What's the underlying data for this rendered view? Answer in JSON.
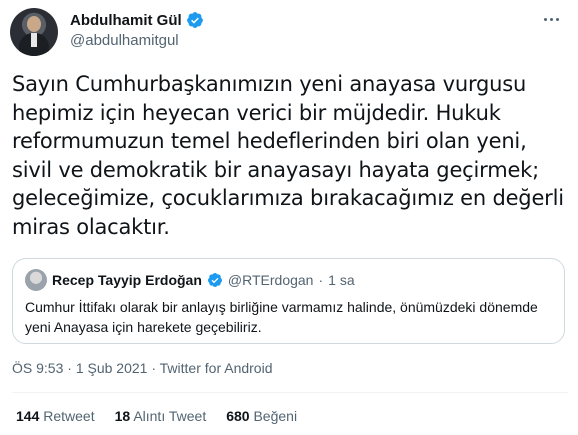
{
  "author": {
    "name": "Abdulhamit Gül",
    "handle": "@abdulhamitgul"
  },
  "tweet": {
    "text": "Sayın Cumhurbaşkanımızın yeni anayasa vurgusu hepimiz için heyecan verici bir müjdedir. Hukuk reformumuzun temel hedeflerinden biri olan yeni, sivil ve demokratik bir anayasayı hayata geçirmek; geleceğimize, çocuklarımıza bırakacağımız en değerli miras olacaktır."
  },
  "quote": {
    "name": "Recep Tayyip Erdoğan",
    "handle": "@RTErdogan",
    "separator": "·",
    "time": "1 sa",
    "text": "Cumhur İttifakı olarak bir anlayış birliğine varmamız halinde, önümüzdeki dönemde yeni Anayasa için harekete geçebiliriz."
  },
  "meta": {
    "time": "ÖS 9:53",
    "date": "1 Şub 2021",
    "separator": "·",
    "source": "Twitter for Android"
  },
  "stats": {
    "retweets_count": "144",
    "retweets_label": "Retweet",
    "quotes_count": "18",
    "quotes_label": "Alıntı Tweet",
    "likes_count": "680",
    "likes_label": "Beğeni"
  },
  "colors": {
    "verified": "#1d9bf0",
    "text": "#0f1419",
    "secondary": "#536471",
    "border": "#cfd9de"
  }
}
